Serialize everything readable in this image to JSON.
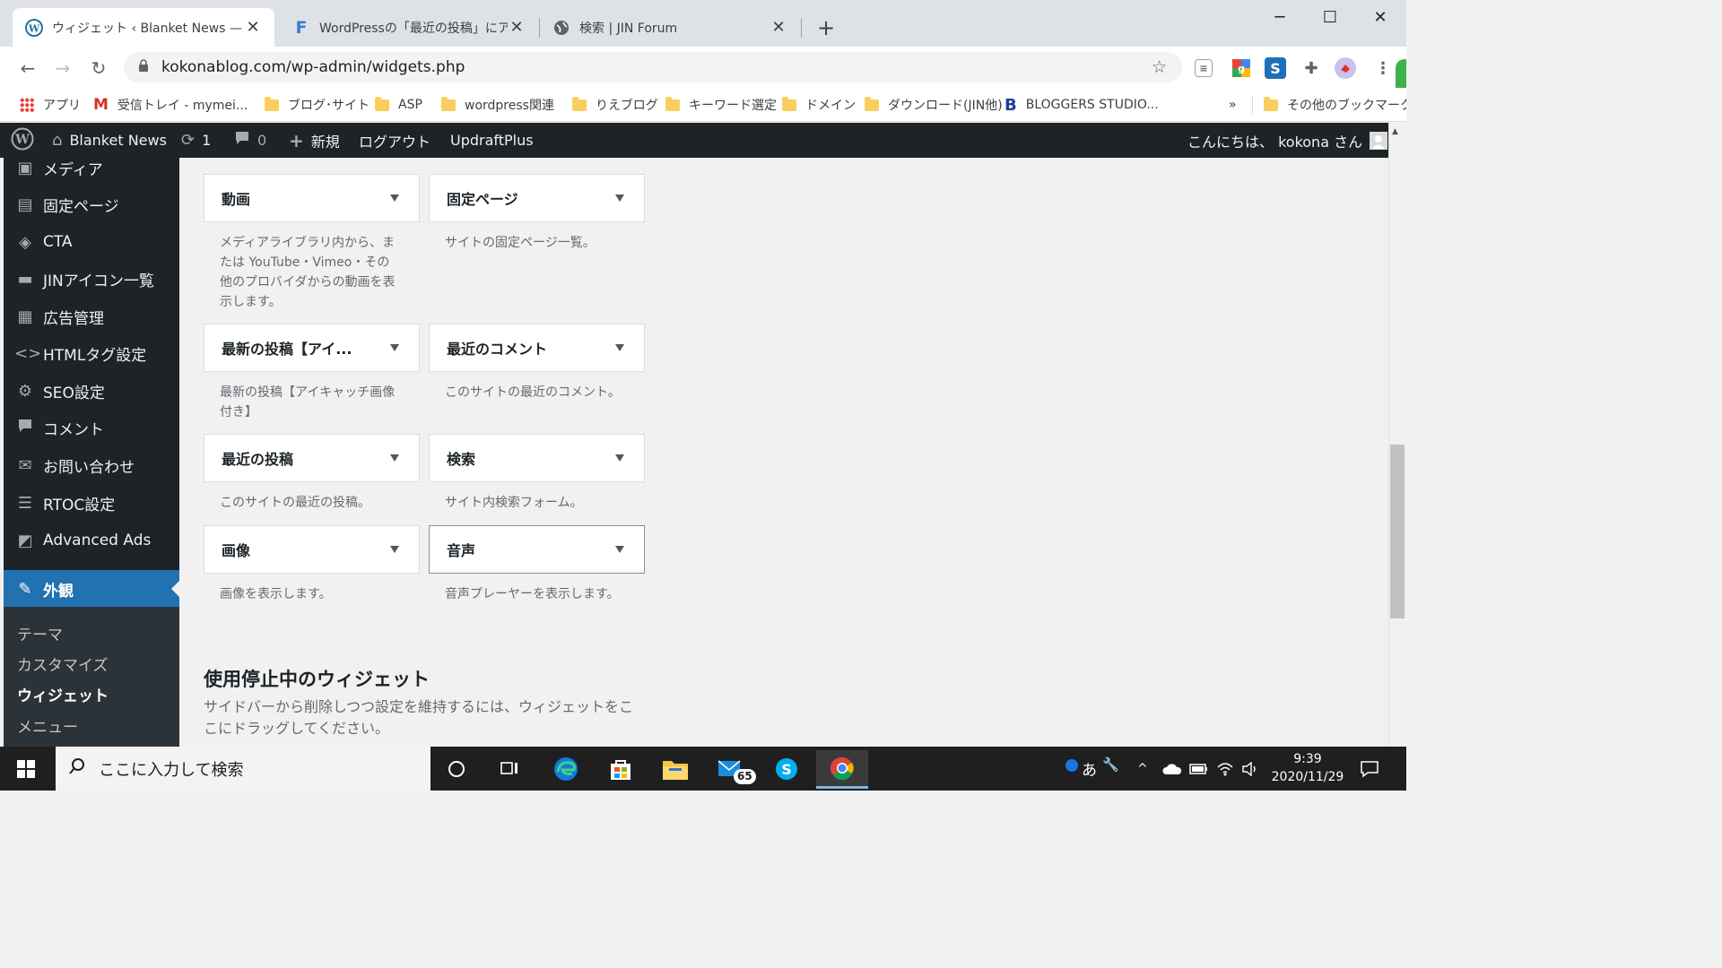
{
  "browser": {
    "tabs": [
      {
        "title": "ウィジェット ‹ Blanket News — WordPress",
        "favicon": "wordpress-icon"
      },
      {
        "title": "WordPressの「最近の投稿」にアイキャッチ",
        "favicon": "F"
      },
      {
        "title": "検索 | JIN Forum",
        "favicon": "globe-icon"
      }
    ],
    "url": "kokonablog.com/wp-admin/widgets.php",
    "bookmarks": [
      {
        "label": "アプリ",
        "icon": "apps-icon"
      },
      {
        "label": "受信トレイ - mymei...",
        "icon": "gmail-icon"
      },
      {
        "label": "ブログ･サイト",
        "icon": "folder-icon"
      },
      {
        "label": "ASP",
        "icon": "folder-icon"
      },
      {
        "label": "wordpress関連",
        "icon": "folder-icon"
      },
      {
        "label": "りえブログ",
        "icon": "folder-icon"
      },
      {
        "label": "キーワード選定",
        "icon": "folder-icon"
      },
      {
        "label": "ドメイン",
        "icon": "folder-icon"
      },
      {
        "label": "ダウンロード(JIN他)",
        "icon": "folder-icon"
      },
      {
        "label": "BLOGGERS STUDIO...",
        "icon": "b-icon"
      },
      {
        "label": "»",
        "icon": ""
      },
      {
        "label": "その他のブックマーク",
        "icon": "folder-icon"
      }
    ]
  },
  "adminbar": {
    "site_name": "Blanket News",
    "updates": "1",
    "comments": "0",
    "new": "新規",
    "logout": "ログアウト",
    "updraft": "UpdraftPlus",
    "greeting": "こんにちは、 kokona さん"
  },
  "sidebar": {
    "items": [
      {
        "label": "メディア",
        "icon": "media-icon"
      },
      {
        "label": "固定ページ",
        "icon": "page-icon"
      },
      {
        "label": "CTA",
        "icon": "cta-icon"
      },
      {
        "label": "JINアイコン一覧",
        "icon": "icon-list-icon"
      },
      {
        "label": "広告管理",
        "icon": "ads-icon"
      },
      {
        "label": "HTMLタグ設定",
        "icon": "code-icon"
      },
      {
        "label": "SEO設定",
        "icon": "gear-icon"
      },
      {
        "label": "コメント",
        "icon": "comment-icon"
      },
      {
        "label": "お問い合わせ",
        "icon": "mail-icon"
      },
      {
        "label": "RTOC設定",
        "icon": "list-icon"
      },
      {
        "label": "Advanced Ads",
        "icon": "advanced-ads-icon"
      },
      {
        "label": "外観",
        "icon": "appearance-icon"
      }
    ],
    "submenu": [
      "テーマ",
      "カスタマイズ",
      "ウィジェット",
      "メニュー"
    ]
  },
  "widgets": [
    {
      "title": "動画",
      "desc": "メディアライブラリ内から、または YouTube・Vimeo・その他のプロバイダからの動画を表示します。"
    },
    {
      "title": "固定ページ",
      "desc": "サイトの固定ページ一覧。"
    },
    {
      "title": "最新の投稿【アイ...",
      "desc": "最新の投稿【アイキャッチ画像付き】"
    },
    {
      "title": "最近のコメント",
      "desc": "このサイトの最近のコメント。"
    },
    {
      "title": "最近の投稿",
      "desc": "このサイトの最近の投稿。"
    },
    {
      "title": "検索",
      "desc": "サイト内検索フォーム。"
    },
    {
      "title": "画像",
      "desc": "画像を表示します。"
    },
    {
      "title": "音声",
      "desc": "音声プレーヤーを表示します。"
    }
  ],
  "inactive": {
    "title": "使用停止中のウィジェット",
    "desc": "サイドバーから削除しつつ設定を維持するには、ウィジェットをここにドラッグしてください。"
  },
  "taskbar": {
    "search_placeholder": "ここに入力して検索",
    "mail_badge": "65",
    "ime": "あ",
    "time": "9:39",
    "date": "2020/11/29"
  }
}
